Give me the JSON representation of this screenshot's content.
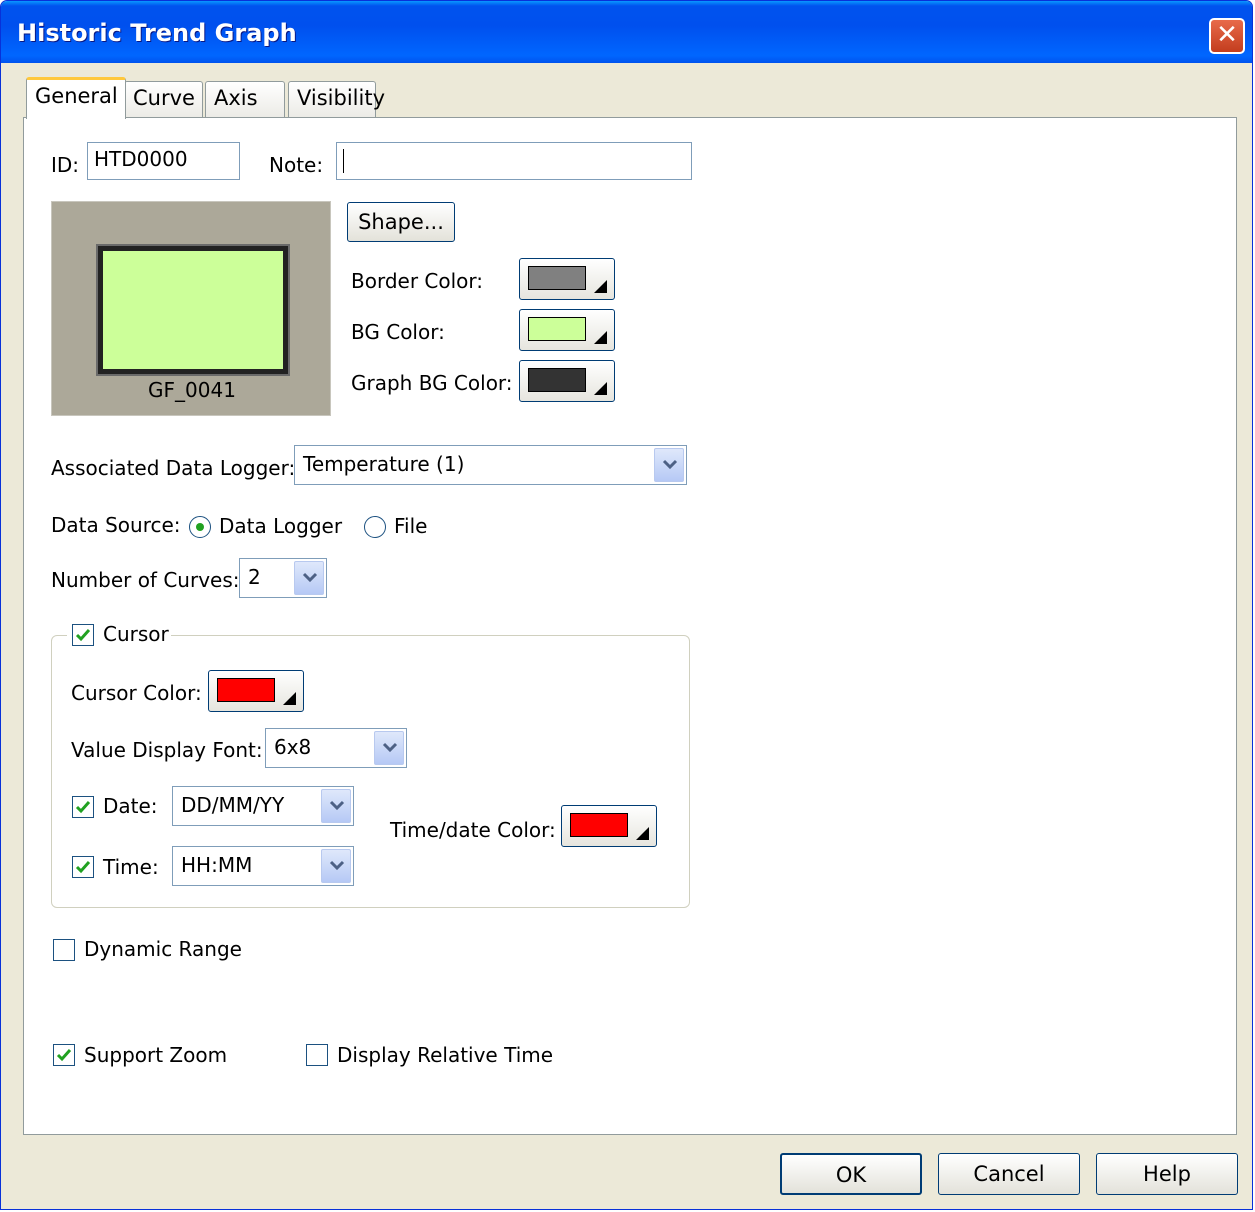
{
  "window": {
    "title": "Historic Trend Graph"
  },
  "tabs": [
    "General",
    "Curve",
    "Axis",
    "Visibility"
  ],
  "general": {
    "id_label": "ID:",
    "id_value": "HTD0000",
    "note_label": "Note:",
    "note_value": "",
    "preview_label": "GF_0041",
    "shape_button": "Shape...",
    "border_color_label": "Border Color:",
    "bg_color_label": "BG Color:",
    "graph_bg_color_label": "Graph BG Color:",
    "data_logger_label": "Associated Data Logger:",
    "data_logger_value": "Temperature (1)",
    "data_source_label": "Data Source:",
    "data_source_options": [
      "Data Logger",
      "File"
    ],
    "data_source_selected": "Data Logger",
    "num_curves_label": "Number of Curves:",
    "num_curves_value": "2",
    "cursor_label": "Cursor",
    "cursor_checked": true,
    "cursor_color_label": "Cursor Color:",
    "value_font_label": "Value Display Font:",
    "value_font_value": "6x8",
    "date_label": "Date:",
    "date_checked": true,
    "date_format": "DD/MM/YY",
    "time_label": "Time:",
    "time_checked": true,
    "time_format": "HH:MM",
    "time_date_color_label": "Time/date Color:",
    "dynamic_range_label": "Dynamic Range",
    "dynamic_range_checked": false,
    "support_zoom_label": "Support Zoom",
    "support_zoom_checked": true,
    "relative_time_label": "Display Relative Time",
    "relative_time_checked": false
  },
  "colors": {
    "border_color": "#808080",
    "bg_color": "#ccff99",
    "graph_bg_color": "#333333",
    "cursor_color": "#ff0000",
    "time_date_color": "#ff0000"
  },
  "buttons": {
    "ok": "OK",
    "cancel": "Cancel",
    "help": "Help"
  }
}
